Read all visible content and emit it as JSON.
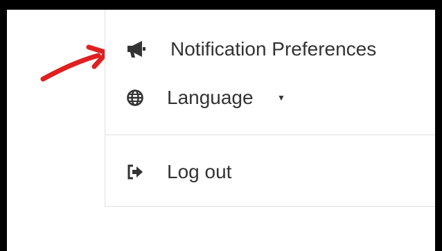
{
  "menu": {
    "items": [
      {
        "label": "Notification Preferences",
        "icon": "megaphone-icon"
      },
      {
        "label": "Language",
        "icon": "globe-icon",
        "caret": "▼"
      },
      {
        "label": "Log out",
        "icon": "logout-icon"
      }
    ]
  },
  "colors": {
    "text": "#333333",
    "divider": "#e0e0e0",
    "annotation_arrow": "#e02020"
  }
}
